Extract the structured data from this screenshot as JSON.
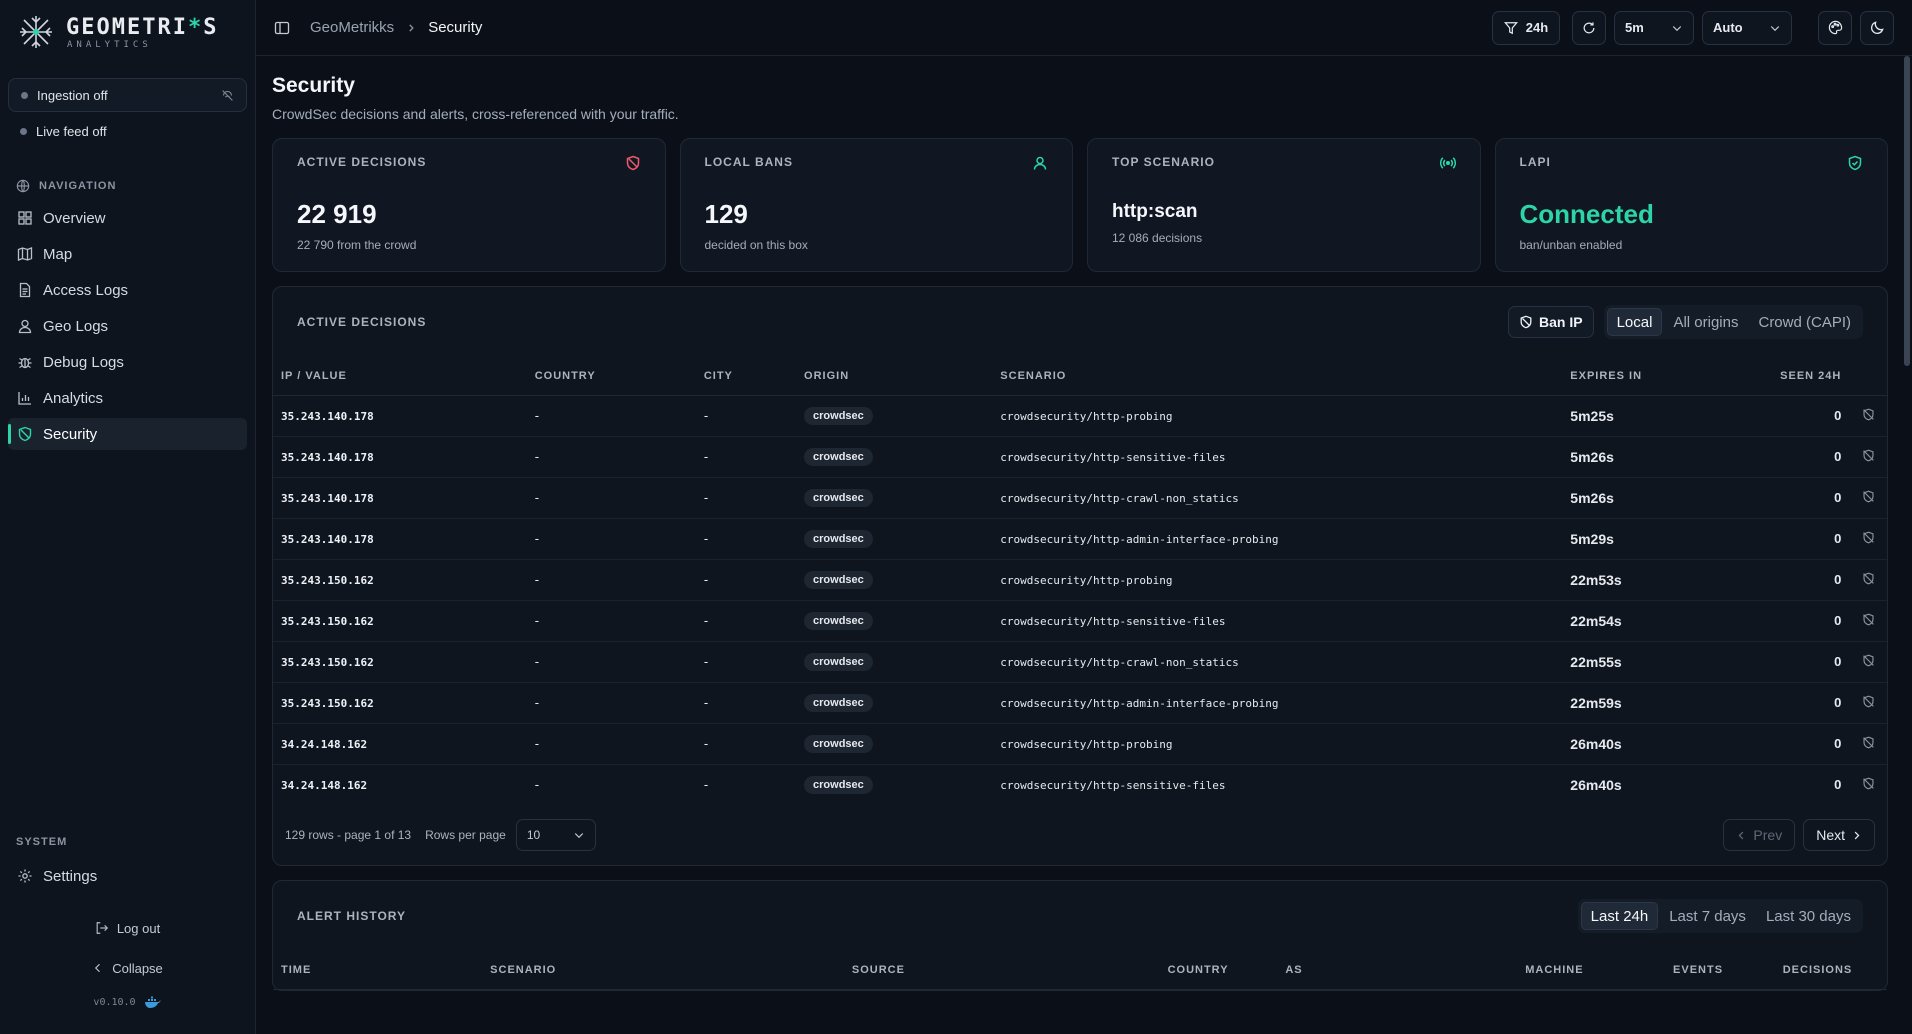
{
  "brand": {
    "title_pre": "GEOMETRI",
    "title_acc": "*",
    "title_post": "S",
    "subtitle": "ANALYTICS"
  },
  "sidebar": {
    "status": [
      {
        "label": "Ingestion off"
      },
      {
        "label": "Live feed off"
      }
    ],
    "nav_label": "NAVIGATION",
    "items": [
      {
        "label": "Overview",
        "icon": "grid-icon"
      },
      {
        "label": "Map",
        "icon": "map-icon"
      },
      {
        "label": "Access Logs",
        "icon": "document-icon"
      },
      {
        "label": "Geo Logs",
        "icon": "user-pin-icon"
      },
      {
        "label": "Debug Logs",
        "icon": "bug-icon"
      },
      {
        "label": "Analytics",
        "icon": "bar-chart-icon"
      },
      {
        "label": "Security",
        "icon": "shield-icon"
      }
    ],
    "system_label": "SYSTEM",
    "settings_label": "Settings",
    "logout_label": "Log out",
    "collapse_label": "Collapse",
    "version": "v0.10.0"
  },
  "topbar": {
    "breadcrumb_root": "GeoMetrikks",
    "breadcrumb_current": "Security",
    "range_label": "24h",
    "interval_value": "5m",
    "mode_value": "Auto"
  },
  "page": {
    "title": "Security",
    "subtitle": "CrowdSec decisions and alerts, cross-referenced with your traffic."
  },
  "cards": [
    {
      "label": "ACTIVE DECISIONS",
      "value": "22 919",
      "note": "22 790 from the crowd",
      "accent": "#f05a6a"
    },
    {
      "label": "LOCAL BANS",
      "value": "129",
      "note": "decided on this box",
      "accent": "#2dd4a7"
    },
    {
      "label": "TOP SCENARIO",
      "value": "http:scan",
      "note": "12 086 decisions",
      "accent": "#2dd4a7"
    },
    {
      "label": "LAPI",
      "value": "Connected",
      "note": "ban/unban enabled",
      "accent": "#2dd4a7"
    }
  ],
  "decisions": {
    "title": "ACTIVE DECISIONS",
    "ban_label": "Ban IP",
    "filters": [
      "Local",
      "All origins",
      "Crowd (CAPI)"
    ],
    "columns": [
      "IP / VALUE",
      "COUNTRY",
      "CITY",
      "ORIGIN",
      "SCENARIO",
      "EXPIRES IN",
      "SEEN 24H"
    ],
    "rows": [
      {
        "ip": "35.243.140.178",
        "country": "-",
        "city": "-",
        "origin": "crowdsec",
        "scenario": "crowdsecurity/http-probing",
        "expires": "5m25s",
        "seen": "0"
      },
      {
        "ip": "35.243.140.178",
        "country": "-",
        "city": "-",
        "origin": "crowdsec",
        "scenario": "crowdsecurity/http-sensitive-files",
        "expires": "5m26s",
        "seen": "0"
      },
      {
        "ip": "35.243.140.178",
        "country": "-",
        "city": "-",
        "origin": "crowdsec",
        "scenario": "crowdsecurity/http-crawl-non_statics",
        "expires": "5m26s",
        "seen": "0"
      },
      {
        "ip": "35.243.140.178",
        "country": "-",
        "city": "-",
        "origin": "crowdsec",
        "scenario": "crowdsecurity/http-admin-interface-probing",
        "expires": "5m29s",
        "seen": "0"
      },
      {
        "ip": "35.243.150.162",
        "country": "-",
        "city": "-",
        "origin": "crowdsec",
        "scenario": "crowdsecurity/http-probing",
        "expires": "22m53s",
        "seen": "0"
      },
      {
        "ip": "35.243.150.162",
        "country": "-",
        "city": "-",
        "origin": "crowdsec",
        "scenario": "crowdsecurity/http-sensitive-files",
        "expires": "22m54s",
        "seen": "0"
      },
      {
        "ip": "35.243.150.162",
        "country": "-",
        "city": "-",
        "origin": "crowdsec",
        "scenario": "crowdsecurity/http-crawl-non_statics",
        "expires": "22m55s",
        "seen": "0"
      },
      {
        "ip": "35.243.150.162",
        "country": "-",
        "city": "-",
        "origin": "crowdsec",
        "scenario": "crowdsecurity/http-admin-interface-probing",
        "expires": "22m59s",
        "seen": "0"
      },
      {
        "ip": "34.24.148.162",
        "country": "-",
        "city": "-",
        "origin": "crowdsec",
        "scenario": "crowdsecurity/http-probing",
        "expires": "26m40s",
        "seen": "0"
      },
      {
        "ip": "34.24.148.162",
        "country": "-",
        "city": "-",
        "origin": "crowdsec",
        "scenario": "crowdsecurity/http-sensitive-files",
        "expires": "26m40s",
        "seen": "0"
      }
    ],
    "pager_info": "129 rows - page 1 of 13",
    "rows_per_page_label": "Rows per page",
    "rows_per_page_value": "10",
    "prev_label": "Prev",
    "next_label": "Next"
  },
  "alerts": {
    "title": "ALERT HISTORY",
    "filters": [
      "Last 24h",
      "Last 7 days",
      "Last 30 days"
    ],
    "columns": [
      "TIME",
      "SCENARIO",
      "SOURCE",
      "COUNTRY",
      "AS",
      "MACHINE",
      "EVENTS",
      "DECISIONS"
    ]
  }
}
